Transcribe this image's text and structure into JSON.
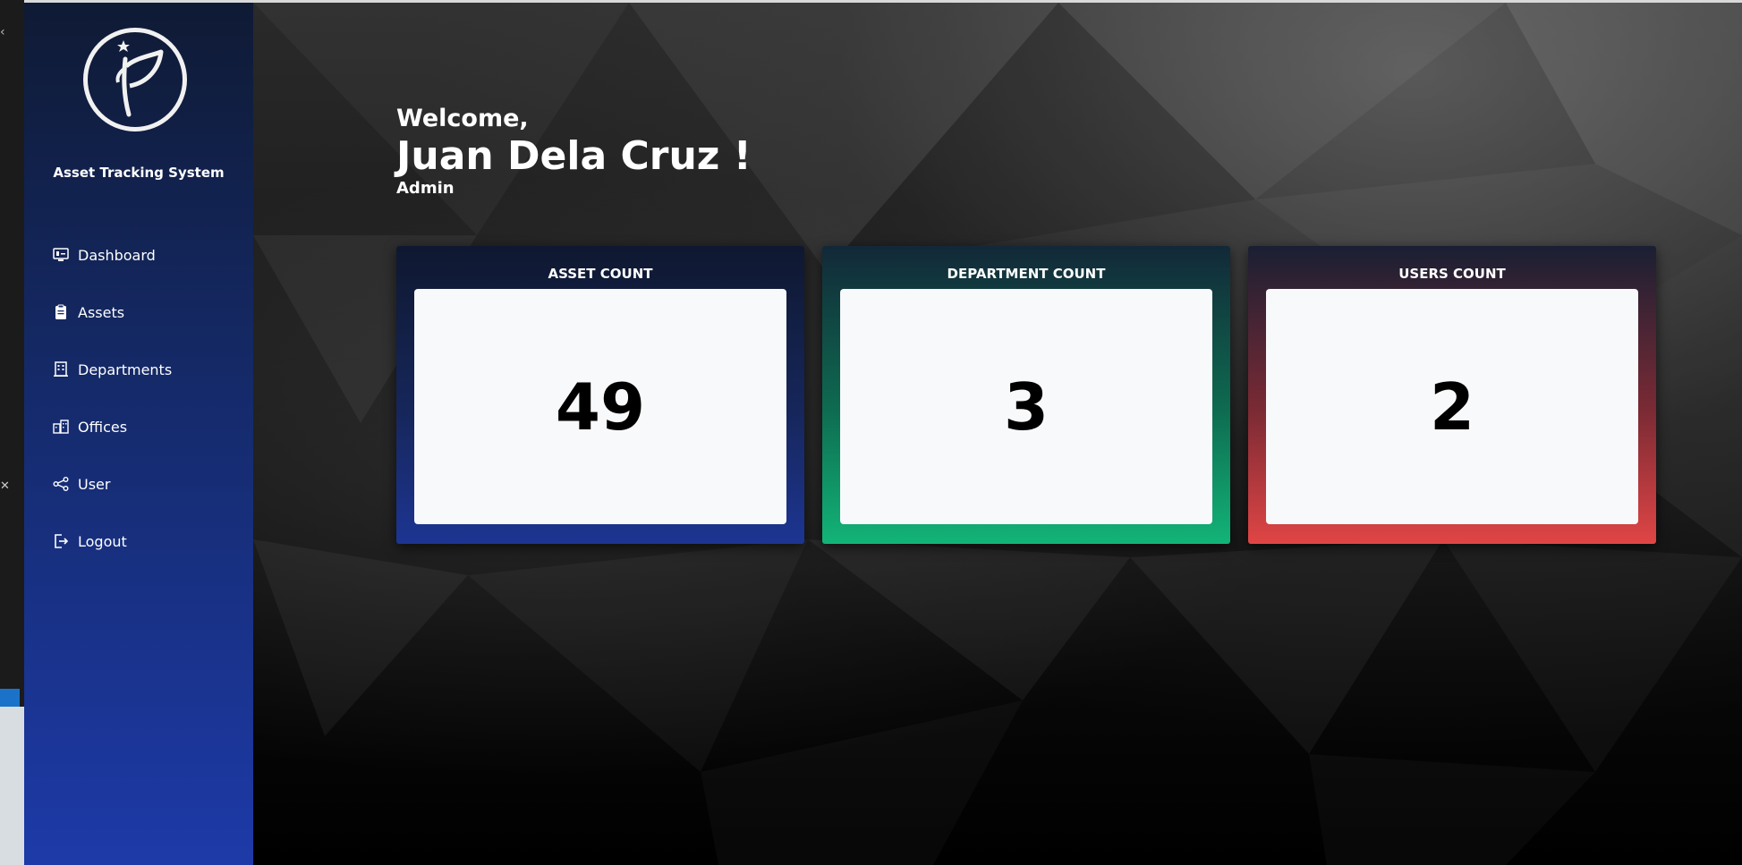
{
  "app": {
    "title": "Asset Tracking System"
  },
  "sidebar": {
    "items": [
      {
        "label": "Dashboard",
        "icon": "monitor-icon"
      },
      {
        "label": "Assets",
        "icon": "clipboard-icon"
      },
      {
        "label": "Departments",
        "icon": "building-icon"
      },
      {
        "label": "Offices",
        "icon": "offices-icon"
      },
      {
        "label": "User",
        "icon": "share-nodes-icon"
      },
      {
        "label": "Logout",
        "icon": "logout-icon"
      }
    ]
  },
  "welcome": {
    "greeting": "Welcome,",
    "name": "Juan Dela Cruz !",
    "role": "Admin"
  },
  "cards": [
    {
      "title": "ASSET COUNT",
      "value": "49",
      "color": "#1d3592"
    },
    {
      "title": "DEPARTMENT COUNT",
      "value": "3",
      "color": "#12b478"
    },
    {
      "title": "USERS COUNT",
      "value": "2",
      "color": "#e04545"
    }
  ],
  "colors": {
    "sidebar_top": "#0f1a34",
    "sidebar_bottom": "#1d3aa8",
    "card_body": "#f8f9fb"
  }
}
